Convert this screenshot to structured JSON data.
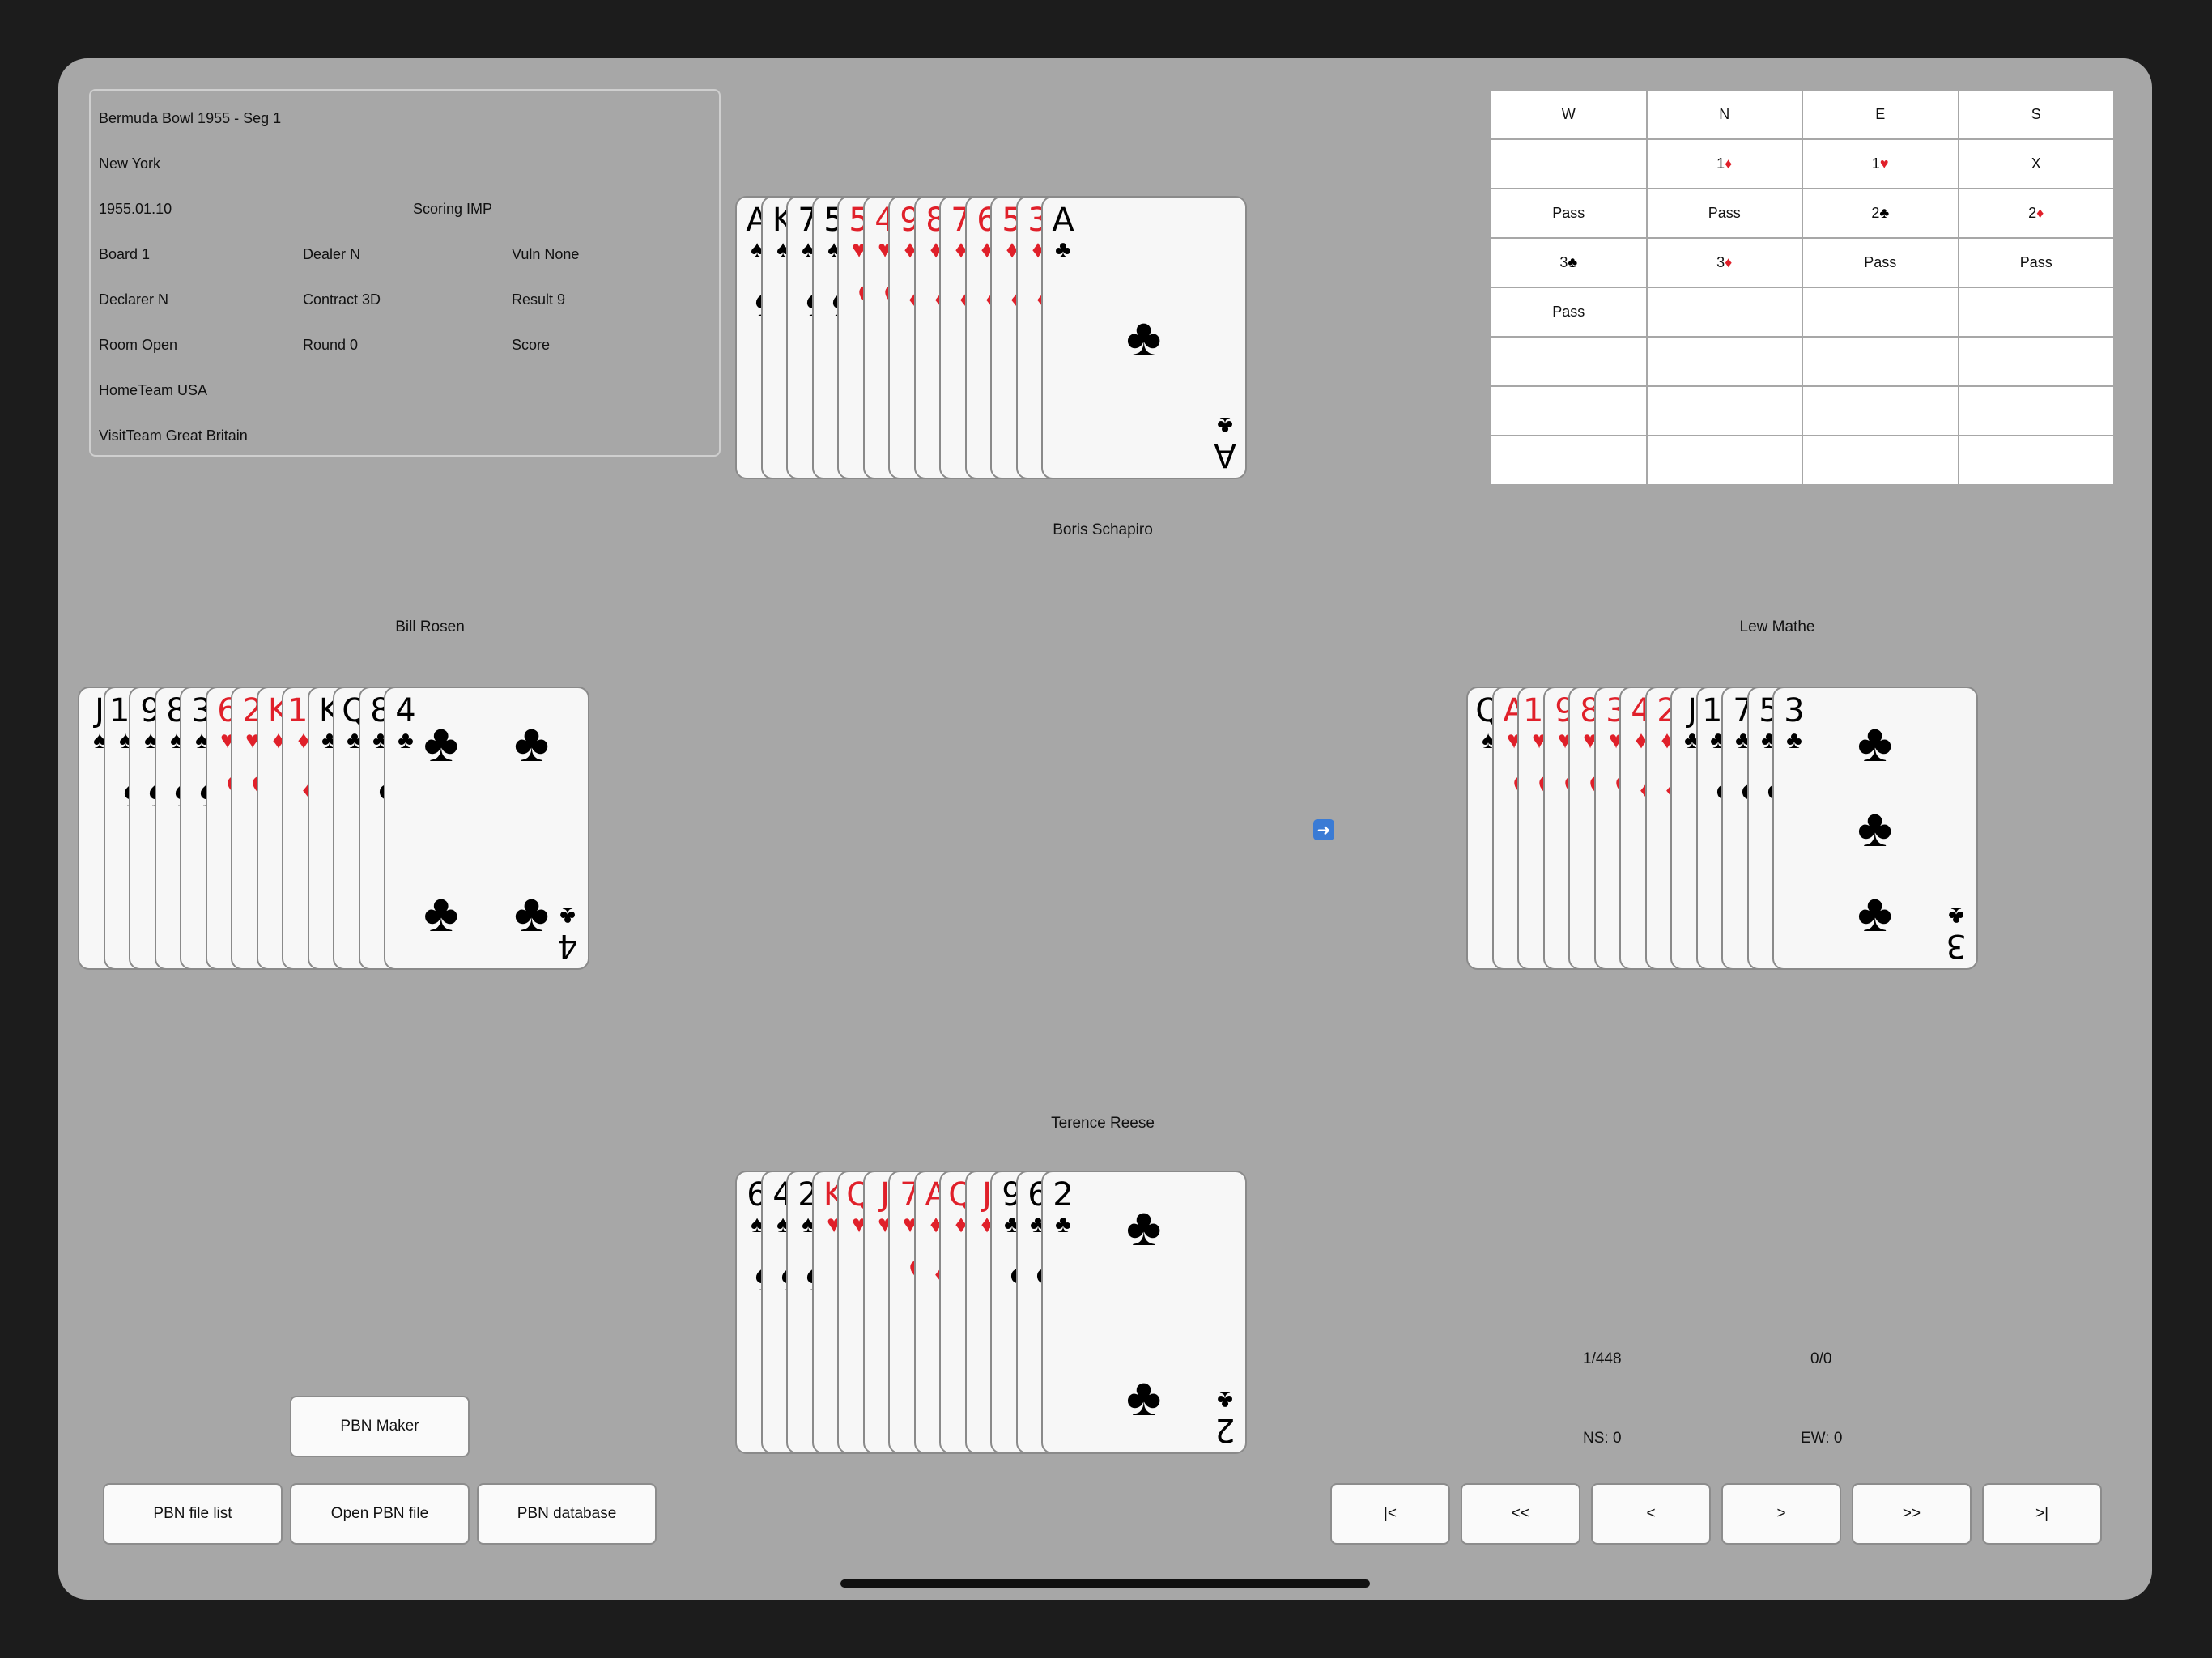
{
  "info": {
    "event": "Bermuda Bowl 1955 - Seg 1",
    "site": "New York",
    "date": "1955.01.10",
    "scoring": "Scoring IMP",
    "board": "Board 1",
    "dealer": "Dealer N",
    "vuln": "Vuln None",
    "declarer": "Declarer N",
    "contract": "Contract 3D",
    "result": "Result 9",
    "room": "Room Open",
    "round": "Round 0",
    "score": "Score",
    "home_team": "HomeTeam USA",
    "visit_team": "VisitTeam Great Britain"
  },
  "auction": {
    "headers": [
      "W",
      "N",
      "E",
      "S"
    ],
    "rows": [
      [
        {
          "text": ""
        },
        {
          "text": "1",
          "suit": "♦",
          "color": "red"
        },
        {
          "text": "1",
          "suit": "♥",
          "color": "red"
        },
        {
          "text": "X"
        }
      ],
      [
        {
          "text": "Pass"
        },
        {
          "text": "Pass"
        },
        {
          "text": "2",
          "suit": "♣",
          "color": "black"
        },
        {
          "text": "2",
          "suit": "♦",
          "color": "red"
        }
      ],
      [
        {
          "text": "3",
          "suit": "♣",
          "color": "black"
        },
        {
          "text": "3",
          "suit": "♦",
          "color": "red"
        },
        {
          "text": "Pass"
        },
        {
          "text": "Pass"
        }
      ],
      [
        {
          "text": "Pass"
        },
        {
          "text": ""
        },
        {
          "text": ""
        },
        {
          "text": ""
        }
      ],
      [
        {
          "text": ""
        },
        {
          "text": ""
        },
        {
          "text": ""
        },
        {
          "text": ""
        }
      ],
      [
        {
          "text": ""
        },
        {
          "text": ""
        },
        {
          "text": ""
        },
        {
          "text": ""
        }
      ],
      [
        {
          "text": ""
        },
        {
          "text": ""
        },
        {
          "text": ""
        },
        {
          "text": ""
        }
      ]
    ]
  },
  "players": {
    "north": "Boris Schapiro",
    "west": "Bill Rosen",
    "east": "Lew Mathe",
    "south": "Terence Reese"
  },
  "hands": {
    "north": [
      {
        "rank": "A",
        "suit": "♠"
      },
      {
        "rank": "K",
        "suit": "♠"
      },
      {
        "rank": "7",
        "suit": "♠"
      },
      {
        "rank": "5",
        "suit": "♠"
      },
      {
        "rank": "5",
        "suit": "♥"
      },
      {
        "rank": "4",
        "suit": "♥"
      },
      {
        "rank": "9",
        "suit": "♦"
      },
      {
        "rank": "8",
        "suit": "♦"
      },
      {
        "rank": "7",
        "suit": "♦"
      },
      {
        "rank": "6",
        "suit": "♦"
      },
      {
        "rank": "5",
        "suit": "♦"
      },
      {
        "rank": "3",
        "suit": "♦"
      },
      {
        "rank": "A",
        "suit": "♣"
      }
    ],
    "west": [
      {
        "rank": "J",
        "suit": "♠"
      },
      {
        "rank": "10",
        "suit": "♠"
      },
      {
        "rank": "9",
        "suit": "♠"
      },
      {
        "rank": "8",
        "suit": "♠"
      },
      {
        "rank": "3",
        "suit": "♠"
      },
      {
        "rank": "6",
        "suit": "♥"
      },
      {
        "rank": "2",
        "suit": "♥"
      },
      {
        "rank": "K",
        "suit": "♦"
      },
      {
        "rank": "10",
        "suit": "♦"
      },
      {
        "rank": "K",
        "suit": "♣"
      },
      {
        "rank": "Q",
        "suit": "♣"
      },
      {
        "rank": "8",
        "suit": "♣"
      },
      {
        "rank": "4",
        "suit": "♣"
      }
    ],
    "east": [
      {
        "rank": "Q",
        "suit": "♠"
      },
      {
        "rank": "A",
        "suit": "♥"
      },
      {
        "rank": "10",
        "suit": "♥"
      },
      {
        "rank": "9",
        "suit": "♥"
      },
      {
        "rank": "8",
        "suit": "♥"
      },
      {
        "rank": "3",
        "suit": "♥"
      },
      {
        "rank": "4",
        "suit": "♦"
      },
      {
        "rank": "2",
        "suit": "♦"
      },
      {
        "rank": "J",
        "suit": "♣"
      },
      {
        "rank": "10",
        "suit": "♣"
      },
      {
        "rank": "7",
        "suit": "♣"
      },
      {
        "rank": "5",
        "suit": "♣"
      },
      {
        "rank": "3",
        "suit": "♣"
      }
    ],
    "south": [
      {
        "rank": "6",
        "suit": "♠"
      },
      {
        "rank": "4",
        "suit": "♠"
      },
      {
        "rank": "2",
        "suit": "♠"
      },
      {
        "rank": "K",
        "suit": "♥"
      },
      {
        "rank": "Q",
        "suit": "♥"
      },
      {
        "rank": "J",
        "suit": "♥"
      },
      {
        "rank": "7",
        "suit": "♥"
      },
      {
        "rank": "A",
        "suit": "♦"
      },
      {
        "rank": "Q",
        "suit": "♦"
      },
      {
        "rank": "J",
        "suit": "♦"
      },
      {
        "rank": "9",
        "suit": "♣"
      },
      {
        "rank": "6",
        "suit": "♣"
      },
      {
        "rank": "2",
        "suit": "♣"
      }
    ]
  },
  "status": {
    "board_counter": "1/448",
    "trick_counter": "0/0",
    "ns": "NS: 0",
    "ew": "EW: 0"
  },
  "buttons": {
    "pbn_maker": "PBN Maker",
    "pbn_file_list": "PBN file list",
    "open_pbn_file": "Open PBN file",
    "pbn_database": "PBN database",
    "first": "|<",
    "prev_fast": "<<",
    "prev": "<",
    "next": ">",
    "next_fast": ">>",
    "last": ">|"
  },
  "icons": {
    "arrow": "arrow-right-icon"
  },
  "colors": {
    "red_suit": "#e0202a",
    "black_suit": "#000000",
    "table_bg": "#a7a7a7"
  }
}
